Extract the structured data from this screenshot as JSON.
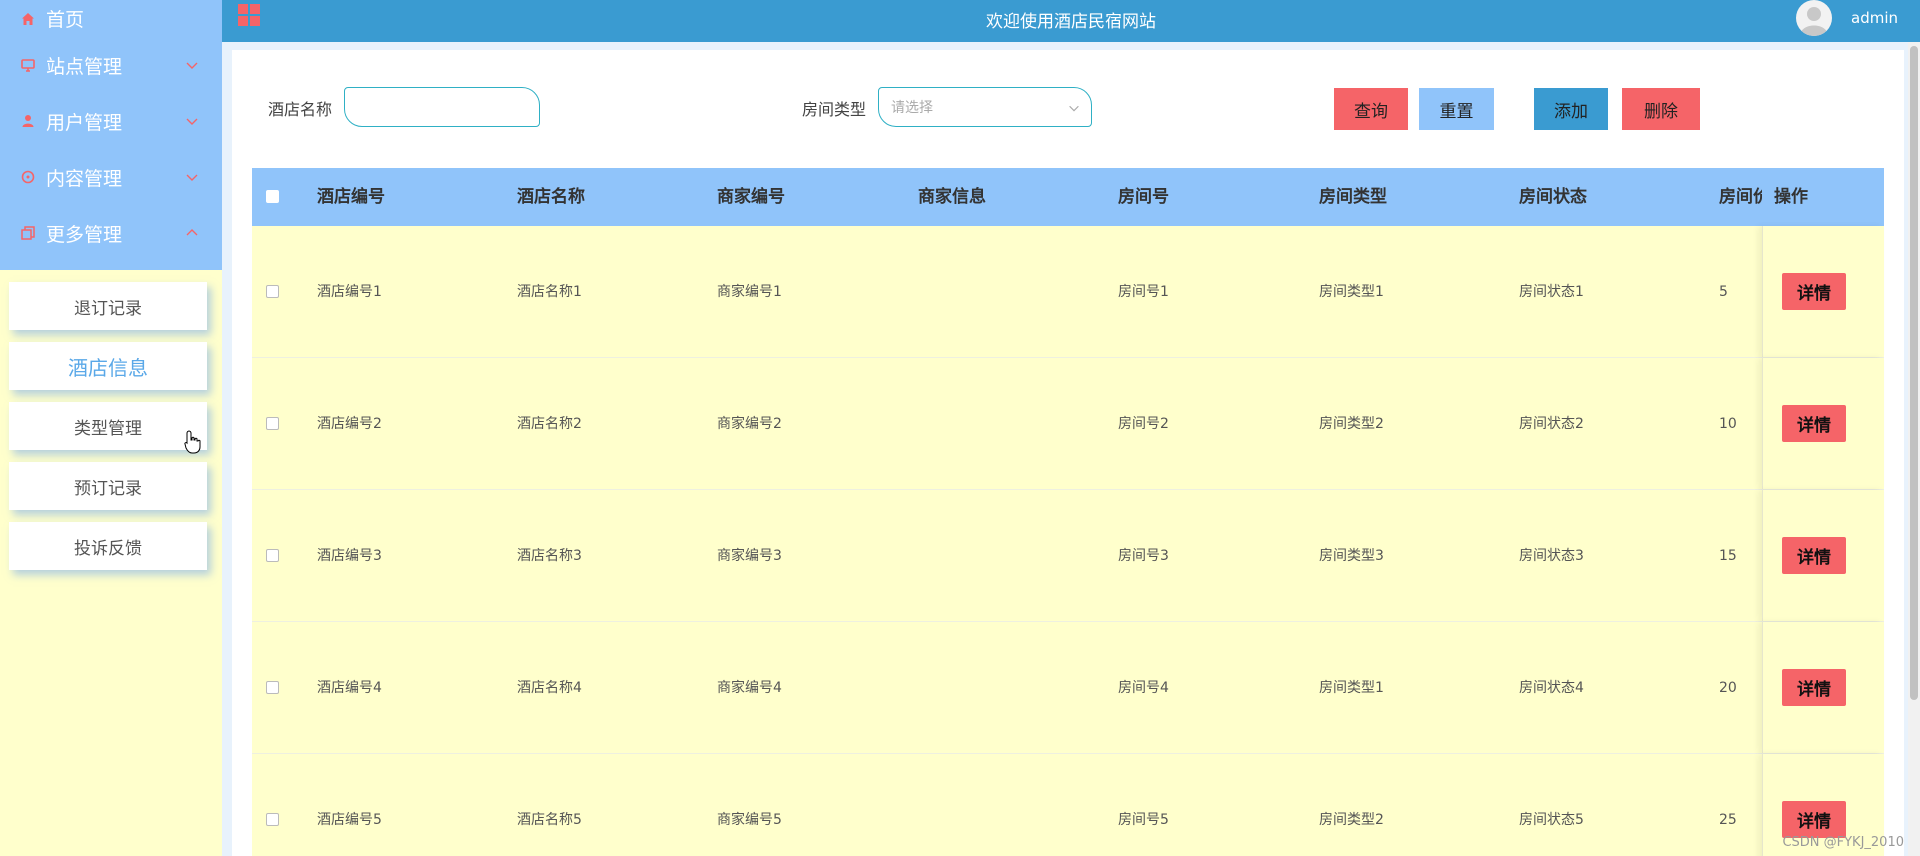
{
  "header": {
    "title": "欢迎使用酒店民宿网站",
    "user": "admin"
  },
  "sidebar": {
    "items": [
      {
        "label": "首页",
        "icon": "home-icon"
      },
      {
        "label": "站点管理",
        "icon": "monitor-icon"
      },
      {
        "label": "用户管理",
        "icon": "user-icon"
      },
      {
        "label": "内容管理",
        "icon": "chat-icon"
      },
      {
        "label": "更多管理",
        "icon": "copy-icon"
      }
    ],
    "submenu": [
      {
        "label": "退订记录"
      },
      {
        "label": "酒店信息"
      },
      {
        "label": "类型管理"
      },
      {
        "label": "预订记录"
      },
      {
        "label": "投诉反馈"
      }
    ]
  },
  "search": {
    "hotel_name_label": "酒店名称",
    "hotel_name_value": "",
    "room_type_label": "房间类型",
    "room_type_placeholder": "请选择",
    "query_label": "查询",
    "reset_label": "重置",
    "add_label": "添加",
    "delete_label": "删除"
  },
  "table": {
    "columns": [
      "酒店编号",
      "酒店名称",
      "商家编号",
      "商家信息",
      "房间号",
      "房间类型",
      "房间状态",
      "房间价格",
      "操作"
    ],
    "detail_label": "详情",
    "rows": [
      [
        "酒店编号1",
        "酒店名称1",
        "商家编号1",
        "",
        "房间号1",
        "房间类型1",
        "房间状态1",
        "5"
      ],
      [
        "酒店编号2",
        "酒店名称2",
        "商家编号2",
        "",
        "房间号2",
        "房间类型2",
        "房间状态2",
        "10"
      ],
      [
        "酒店编号3",
        "酒店名称3",
        "商家编号3",
        "",
        "房间号3",
        "房间类型3",
        "房间状态3",
        "15"
      ],
      [
        "酒店编号4",
        "酒店名称4",
        "商家编号4",
        "",
        "房间号4",
        "房间类型1",
        "房间状态4",
        "20"
      ],
      [
        "酒店编号5",
        "酒店名称5",
        "商家编号5",
        "",
        "房间号5",
        "房间类型2",
        "房间状态5",
        "25"
      ]
    ]
  },
  "watermark": "CSDN @FYKJ_2010",
  "colors": {
    "header": "#3a9bd1",
    "sidebar_menu": "#90c4fa",
    "background": "#ffffcc",
    "table_head": "#90c4fa",
    "danger": "#f56468",
    "primary": "#3a9bd1",
    "light_blue": "#90c4fa",
    "icon_red": "#f56468"
  }
}
